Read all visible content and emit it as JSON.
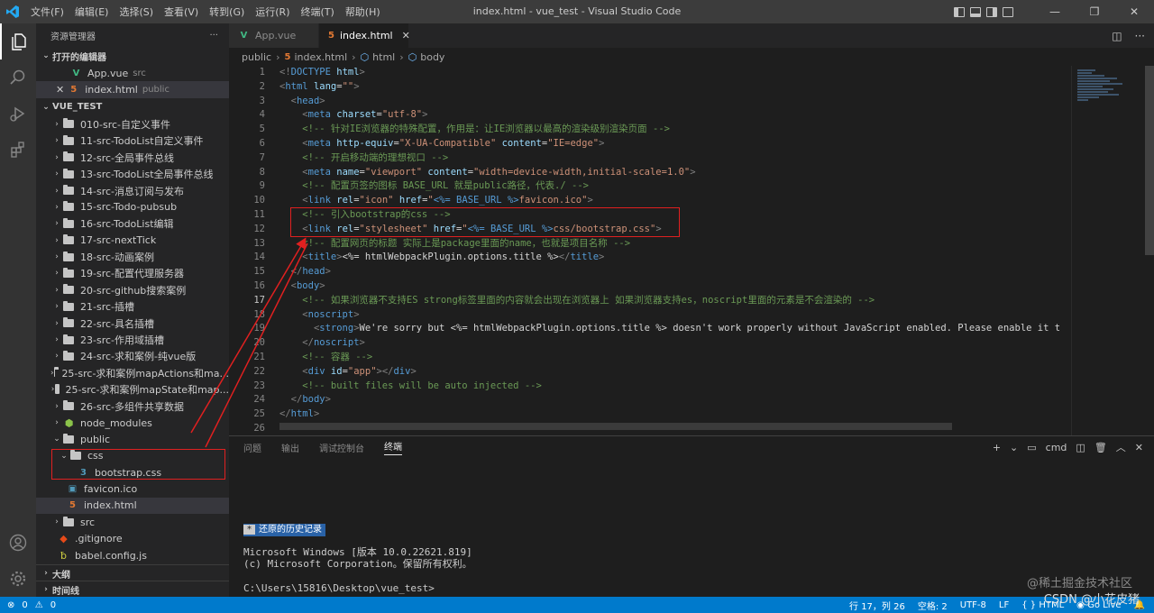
{
  "window": {
    "title": "index.html - vue_test - Visual Studio Code",
    "menu": [
      "文件(F)",
      "编辑(E)",
      "选择(S)",
      "查看(V)",
      "转到(G)",
      "运行(R)",
      "终端(T)",
      "帮助(H)"
    ]
  },
  "sidebar": {
    "title": "资源管理器",
    "open_editors_label": "打开的编辑器",
    "open_editors": [
      {
        "name": "App.vue",
        "desc": "src"
      },
      {
        "name": "index.html",
        "desc": "public"
      }
    ],
    "workspace_label": "VUE_TEST",
    "tree": [
      "010-src-自定义事件",
      "11-src-TodoList自定义事件",
      "12-src-全局事件总线",
      "13-src-TodoList全局事件总线",
      "14-src-消息订阅与发布",
      "15-src-Todo-pubsub",
      "16-src-TodoList编辑",
      "17-src-nextTick",
      "18-src-动画案例",
      "19-src-配置代理服务器",
      "20-src-github搜索案例",
      "21-src-插槽",
      "22-src-具名插槽",
      "23-src-作用域插槽",
      "24-src-求和案例-纯vue版",
      "25-src-求和案例mapActions和ma...",
      "25-src-求和案例mapState和map...",
      "26-src-多组件共享数据"
    ],
    "node_modules": "node_modules",
    "public": "public",
    "css_folder": "css",
    "bootstrap": "bootstrap.css",
    "favicon": "favicon.ico",
    "index_html": "index.html",
    "src": "src",
    "gitignore": ".gitignore",
    "babel": "babel.config.js",
    "outline_label": "大纲",
    "timeline_label": "时间线"
  },
  "tabs": [
    {
      "label": "App.vue"
    },
    {
      "label": "index.html"
    }
  ],
  "breadcrumb": [
    "public",
    "index.html",
    "html",
    "body"
  ],
  "editor": {
    "lines": [
      "1",
      "2",
      "3",
      "4",
      "5",
      "6",
      "7",
      "8",
      "9",
      "10",
      "11",
      "12",
      "13",
      "14",
      "15",
      "16",
      "17",
      "18",
      "19",
      "20",
      "21",
      "22",
      "23",
      "24",
      "25",
      "26"
    ],
    "current_line": "17"
  },
  "panel": {
    "tabs": [
      "问题",
      "输出",
      "调试控制台",
      "终端"
    ],
    "shell": "cmd",
    "restored_label": "还原的历史记录",
    "restored_star": "*",
    "terminal_lines": [
      "Microsoft Windows [版本 10.0.22621.819]",
      "(c) Microsoft Corporation。保留所有权利。",
      "",
      "C:\\Users\\15816\\Desktop\\vue_test>"
    ]
  },
  "statusbar": {
    "errors": "0",
    "warnings": "0",
    "position": "行 17，列 26",
    "spaces": "空格: 2",
    "encoding": "UTF-8",
    "eol": "LF",
    "language": "HTML",
    "golive": "Go Live"
  },
  "watermark": {
    "line1": "@稀土掘金技术社区",
    "line2": "CSDN @小花皮猪"
  },
  "colors": {
    "accent": "#007acc",
    "annotation": "#e02020"
  }
}
